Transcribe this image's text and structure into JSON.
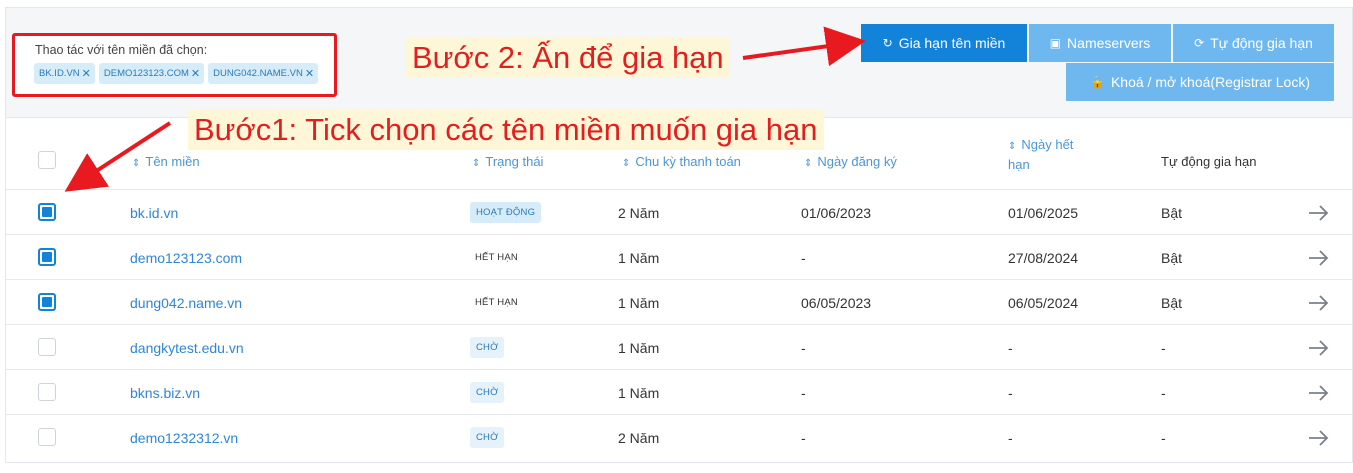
{
  "selection": {
    "title": "Thao tác với tên miền đã chọn:",
    "chips": [
      "BK.ID.VN",
      "DEMO123123.COM",
      "DUNG042.NAME.VN"
    ]
  },
  "actions": {
    "renew": "Gia hạn tên miền",
    "nameservers": "Nameservers",
    "auto_renew": "Tự động gia hạn",
    "lock": "Khoá / mở khoá(Registrar Lock)"
  },
  "annotations": {
    "step2": "Bước 2: Ấn để gia hạn",
    "step1": "Bước1: Tick chọn các tên miền muốn gia hạn",
    "color": "#e01f1f"
  },
  "table": {
    "headers": {
      "domain": "Tên miền",
      "status": "Trạng thái",
      "billing": "Chu kỳ thanh toán",
      "registered": "Ngày đăng ký",
      "expiry_line1": "Ngày hết",
      "expiry_line2": "hạn",
      "auto_renew": "Tự động gia hạn"
    },
    "rows": [
      {
        "domain": "bk.id.vn",
        "status": "HOẠT ĐỘNG",
        "status_type": "active",
        "billing": "2 Năm",
        "registered": "01/06/2023",
        "expiry": "01/06/2025",
        "auto": "Bật",
        "checked": true
      },
      {
        "domain": "demo123123.com",
        "status": "HẾT HẠN",
        "status_type": "expired",
        "billing": "1 Năm",
        "registered": "-",
        "expiry": "27/08/2024",
        "auto": "Bật",
        "checked": true
      },
      {
        "domain": "dung042.name.vn",
        "status": "HẾT HẠN",
        "status_type": "expired",
        "billing": "1 Năm",
        "registered": "06/05/2023",
        "expiry": "06/05/2024",
        "auto": "Bật",
        "checked": true
      },
      {
        "domain": "dangkytest.edu.vn",
        "status": "CHỜ",
        "status_type": "pending",
        "billing": "1 Năm",
        "registered": "-",
        "expiry": "-",
        "auto": "-",
        "checked": false
      },
      {
        "domain": "bkns.biz.vn",
        "status": "CHỜ",
        "status_type": "pending",
        "billing": "1 Năm",
        "registered": "-",
        "expiry": "-",
        "auto": "-",
        "checked": false
      },
      {
        "domain": "demo1232312.vn",
        "status": "CHỜ",
        "status_type": "pending",
        "billing": "2 Năm",
        "registered": "-",
        "expiry": "-",
        "auto": "-",
        "checked": false
      }
    ]
  },
  "icons": {
    "renew": "refresh-icon",
    "nameservers": "server-icon",
    "auto_renew": "sync-icon",
    "lock": "lock-icon",
    "row_action": "arrow-right-icon"
  },
  "colors": {
    "primary": "#1283d9",
    "primary_light": "#6fb8ef",
    "link": "#2f86d6"
  }
}
